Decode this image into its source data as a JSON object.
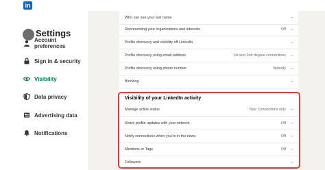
{
  "logo": "in",
  "sidebar": {
    "title": "Settings",
    "items": [
      {
        "label": "Account preferences",
        "icon": "person-icon"
      },
      {
        "label": "Sign in & security",
        "icon": "lock-icon"
      },
      {
        "label": "Visibility",
        "icon": "eye-icon"
      },
      {
        "label": "Data privacy",
        "icon": "shield-icon"
      },
      {
        "label": "Advertising data",
        "icon": "newspaper-icon"
      },
      {
        "label": "Notifications",
        "icon": "bell-icon"
      }
    ],
    "active_color": "#057642"
  },
  "profile_section": {
    "rows": [
      {
        "label": "Who can see your last name",
        "value": ""
      },
      {
        "label": "Representing your organizations and interests",
        "value": "Off"
      },
      {
        "label": "Profile discovery and visibility off LinkedIn",
        "value": ""
      },
      {
        "label": "Profile discovery using email address",
        "value": "1st and 2nd degree connections"
      },
      {
        "label": "Profile discovery using phone number",
        "value": "Nobody"
      },
      {
        "label": "Blocking",
        "value": ""
      }
    ]
  },
  "activity_section": {
    "title": "Visibility of your LinkedIn activity",
    "rows": [
      {
        "label": "Manage active status",
        "value": "Your Connections only"
      },
      {
        "label": "Share profile updates with your network",
        "value": "Off"
      },
      {
        "label": "Notify connections when you're in the news",
        "value": "Off"
      },
      {
        "label": "Mentions or Tags",
        "value": "Off"
      },
      {
        "label": "Followers",
        "value": ""
      }
    ],
    "highlight_color": "#e03b35"
  },
  "arrow_glyph": "→"
}
